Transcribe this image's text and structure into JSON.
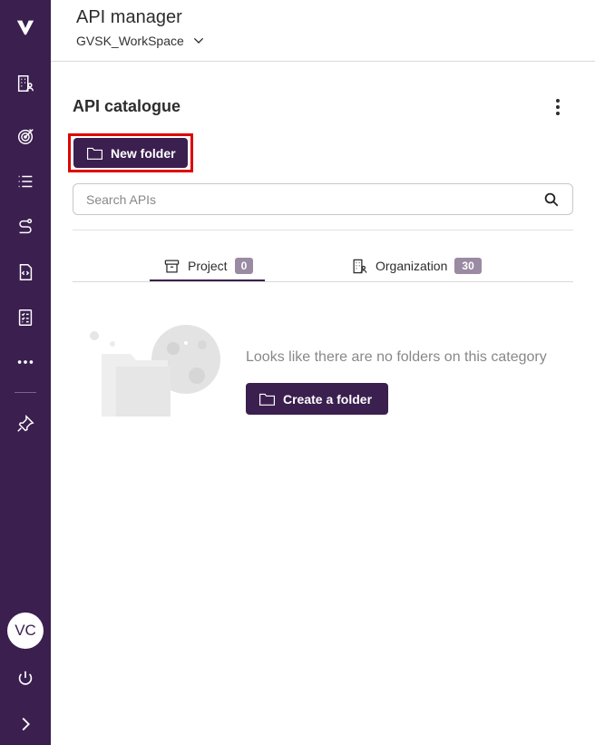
{
  "header": {
    "title": "API manager",
    "workspace": "GVSK_WorkSpace"
  },
  "sidebar": {
    "logo": "V",
    "items": [
      {
        "icon": "building-person-icon"
      },
      {
        "icon": "target-icon"
      },
      {
        "icon": "list-icon"
      },
      {
        "icon": "route-icon"
      },
      {
        "icon": "code-document-icon"
      },
      {
        "icon": "checklist-icon"
      },
      {
        "icon": "more-icon"
      },
      {
        "icon": "pin-icon"
      }
    ],
    "avatar_initials": "VC",
    "power_icon": "power-icon",
    "expand_icon": "chevron-right-icon"
  },
  "catalogue": {
    "title": "API catalogue",
    "new_folder_label": "New folder",
    "search_placeholder": "Search APIs"
  },
  "tabs": [
    {
      "label": "Project",
      "count": "0",
      "active": true
    },
    {
      "label": "Organization",
      "count": "30",
      "active": false
    }
  ],
  "empty_state": {
    "message": "Looks like there are no folders on this category",
    "create_label": "Create a folder"
  },
  "colors": {
    "brand": "#3b1f4f",
    "badge": "#9a8aa2",
    "highlight": "#e00000"
  }
}
